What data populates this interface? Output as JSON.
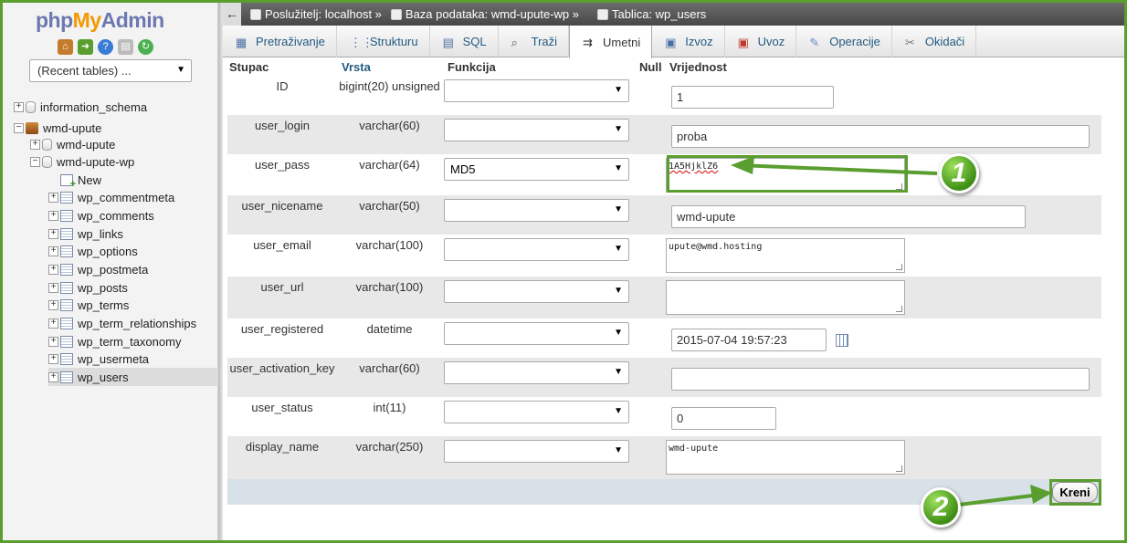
{
  "app": {
    "logo_php": "php",
    "logo_my": "My",
    "logo_admin": "Admin"
  },
  "sidebar": {
    "recent_tables": "(Recent tables) ...",
    "tree": [
      {
        "label": "information_schema",
        "kind": "db",
        "expanded": false
      },
      {
        "label": "wmd-upute",
        "kind": "server-db",
        "expanded": true
      },
      {
        "label": "wmd-upute",
        "kind": "db",
        "expanded": false
      },
      {
        "label": "wmd-upute-wp",
        "kind": "db",
        "expanded": true
      },
      {
        "label": "New",
        "kind": "new"
      },
      {
        "label": "wp_commentmeta",
        "kind": "table"
      },
      {
        "label": "wp_comments",
        "kind": "table"
      },
      {
        "label": "wp_links",
        "kind": "table"
      },
      {
        "label": "wp_options",
        "kind": "table"
      },
      {
        "label": "wp_postmeta",
        "kind": "table"
      },
      {
        "label": "wp_posts",
        "kind": "table"
      },
      {
        "label": "wp_terms",
        "kind": "table"
      },
      {
        "label": "wp_term_relationships",
        "kind": "table"
      },
      {
        "label": "wp_term_taxonomy",
        "kind": "table"
      },
      {
        "label": "wp_usermeta",
        "kind": "table"
      },
      {
        "label": "wp_users",
        "kind": "table",
        "selected": true
      }
    ]
  },
  "breadcrumb": {
    "back": "←",
    "server": "Poslužitelj: localhost »",
    "database": "Baza podataka: wmd-upute-wp »",
    "table": "Tablica: wp_users"
  },
  "tabs": [
    {
      "label": "Pretraživanje",
      "icon": "browse-icon"
    },
    {
      "label": "Strukturu",
      "icon": "structure-icon"
    },
    {
      "label": "SQL",
      "icon": "sql-icon"
    },
    {
      "label": "Traži",
      "icon": "search-icon"
    },
    {
      "label": "Umetni",
      "icon": "insert-icon",
      "active": true
    },
    {
      "label": "Izvoz",
      "icon": "export-icon"
    },
    {
      "label": "Uvoz",
      "icon": "import-icon"
    },
    {
      "label": "Operacije",
      "icon": "wrench-icon"
    },
    {
      "label": "Okidači",
      "icon": "triggers-icon"
    }
  ],
  "headers": {
    "column": "Stupac",
    "type": "Vrsta",
    "function": "Funkcija",
    "null": "Null",
    "value": "Vrijednost"
  },
  "rows": [
    {
      "column": "ID",
      "type": "bigint(20) unsigned",
      "function": "",
      "value": "1"
    },
    {
      "column": "user_login",
      "type": "varchar(60)",
      "function": "",
      "value": "proba"
    },
    {
      "column": "user_pass",
      "type": "varchar(64)",
      "function": "MD5",
      "value": "1A5HjklZ6"
    },
    {
      "column": "user_nicename",
      "type": "varchar(50)",
      "function": "",
      "value": "wmd-upute"
    },
    {
      "column": "user_email",
      "type": "varchar(100)",
      "function": "",
      "value": "upute@wmd.hosting"
    },
    {
      "column": "user_url",
      "type": "varchar(100)",
      "function": "",
      "value": ""
    },
    {
      "column": "user_registered",
      "type": "datetime",
      "function": "",
      "value": "2015-07-04 19:57:23"
    },
    {
      "column": "user_activation_key",
      "type": "varchar(60)",
      "function": "",
      "value": ""
    },
    {
      "column": "user_status",
      "type": "int(11)",
      "function": "",
      "value": "0"
    },
    {
      "column": "display_name",
      "type": "varchar(250)",
      "function": "",
      "value": "wmd-upute"
    }
  ],
  "go_button": "Kreni",
  "annotations": [
    "1",
    "2"
  ],
  "colors": {
    "accent_green": "#5a9e2f",
    "link_blue": "#235a81"
  }
}
